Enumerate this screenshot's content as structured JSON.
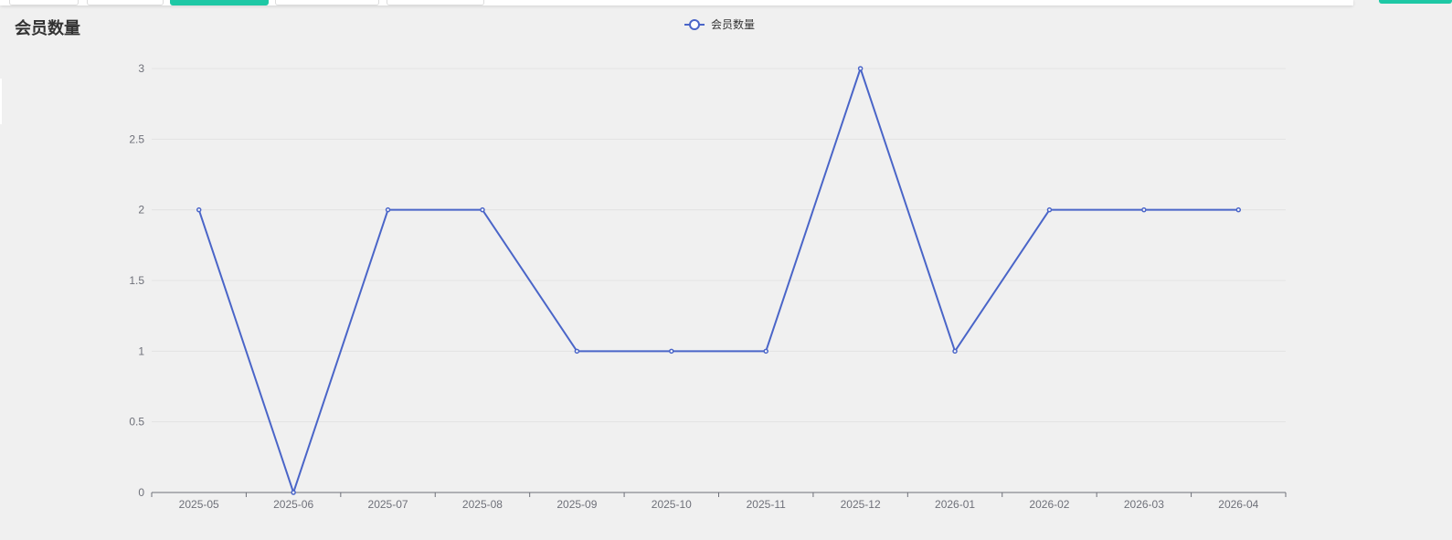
{
  "page": {
    "title": "会员数量"
  },
  "chart_data": {
    "type": "line",
    "title": "会员数量",
    "categories": [
      "2025-05",
      "2025-06",
      "2025-07",
      "2025-08",
      "2025-09",
      "2025-10",
      "2025-11",
      "2025-12",
      "2026-01",
      "2026-02",
      "2026-03",
      "2026-04"
    ],
    "series": [
      {
        "name": "会员数量",
        "values": [
          2,
          0,
          2,
          2,
          1,
          1,
          1,
          3,
          1,
          2,
          2,
          2
        ]
      }
    ],
    "ylim": [
      0,
      3
    ],
    "yticks": [
      0,
      0.5,
      1,
      1.5,
      2,
      2.5,
      3
    ],
    "xlabel": "",
    "ylabel": "",
    "grid": true,
    "legend_position": "top-center",
    "colors": {
      "series": "#4a65c8",
      "grid": "#e3e3e3",
      "axis": "#6e7079"
    }
  }
}
